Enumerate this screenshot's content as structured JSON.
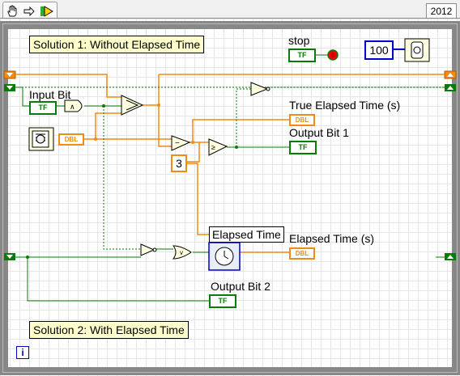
{
  "toolbar": {
    "version": "2012",
    "icons": [
      "hand-icon",
      "arrow-icon",
      "run-highlight-icon"
    ]
  },
  "comments": {
    "solution1": "Solution 1: Without Elapsed Time",
    "solution2": "Solution 2: With Elapsed Time"
  },
  "labels": {
    "stop": "stop",
    "input_bit": "Input Bit",
    "true_elapsed": "True Elapsed Time (s)",
    "output_bit1": "Output Bit 1",
    "elapsed_time_box": "Elapsed Time",
    "elapsed_time_s": "Elapsed Time (s)",
    "output_bit2": "Output Bit 2"
  },
  "terminals": {
    "bool": "TF",
    "dbl": "DBL"
  },
  "constants": {
    "wait_ms": "100",
    "threshold": "3"
  },
  "loop_info": "i",
  "colors": {
    "bool_wire": "#0a7a0a",
    "dbl_wire": "#f08c14",
    "int_wire": "#0000c8",
    "stop_led": "#ff0000"
  }
}
